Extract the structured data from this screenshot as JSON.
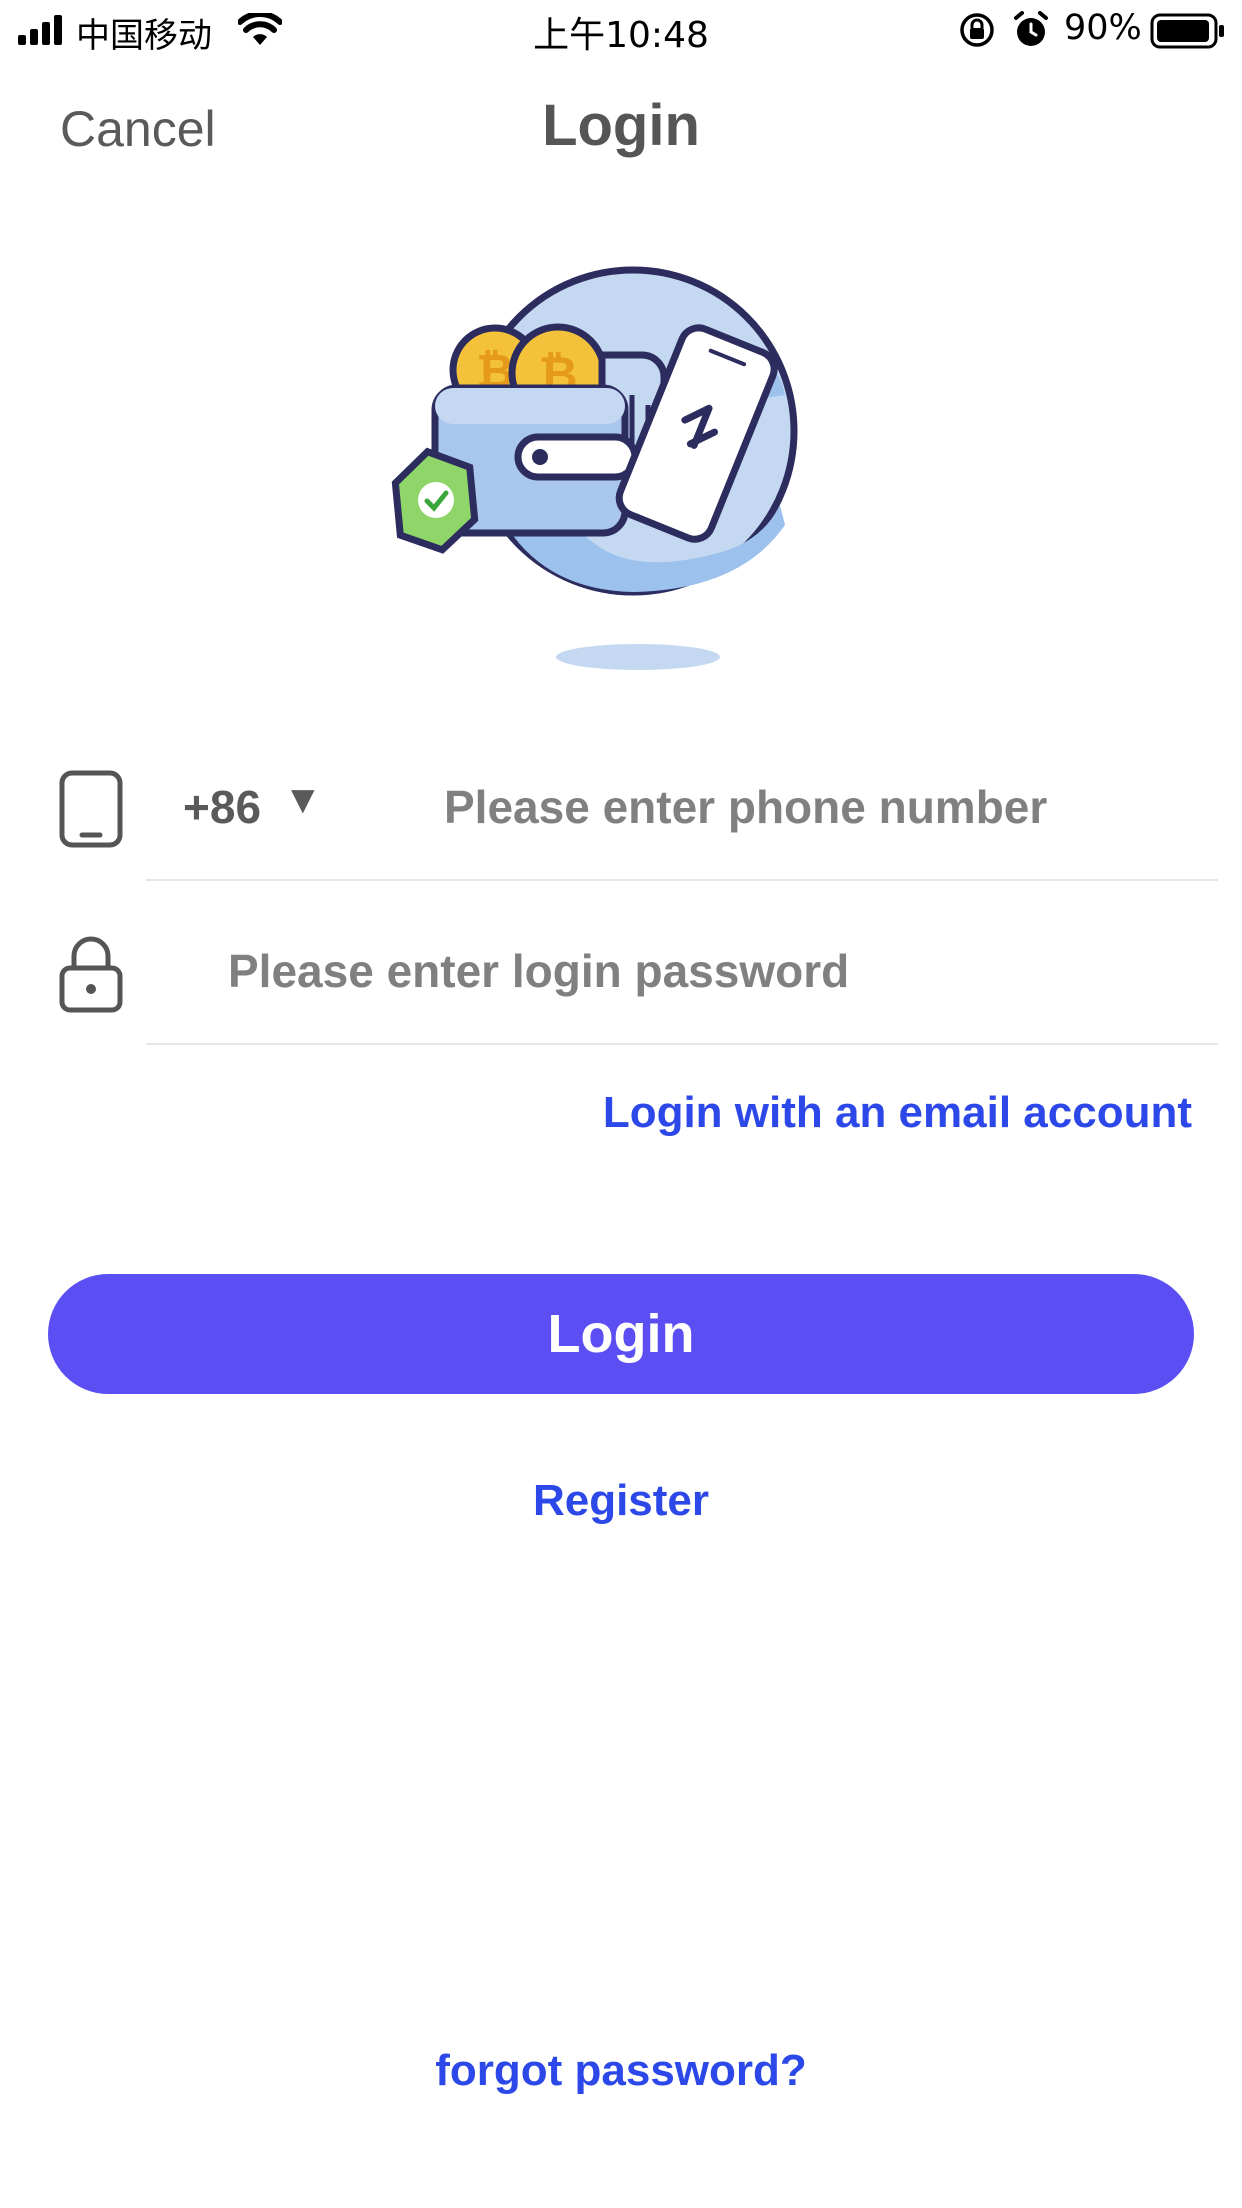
{
  "status_bar": {
    "carrier": "中国移动",
    "time": "上午10:48",
    "battery": "90%",
    "icons": [
      "signal-icon",
      "wifi-icon",
      "rotation-lock-icon",
      "alarm-icon",
      "battery-icon"
    ]
  },
  "nav": {
    "cancel_label": "Cancel",
    "title": "Login"
  },
  "illustration": {
    "icons": [
      "globe-icon",
      "wallet-icon",
      "bitcoin-coin-icon",
      "shield-check-icon",
      "phone-transfer-icon"
    ]
  },
  "form": {
    "phone_icon": "phone-icon",
    "country_code": "+86",
    "country_arrow": "▼",
    "phone_placeholder": "Please enter phone number",
    "phone_value": "",
    "lock_icon": "lock-icon",
    "password_placeholder": "Please enter login password",
    "password_value": "",
    "email_login_label": "Login with an email account",
    "login_label": "Login",
    "register_label": "Register",
    "forgot_label": "forgot password?"
  },
  "colors": {
    "accent": "#5b4ff3",
    "link": "#2d48e8",
    "text": "#555555",
    "placeholder": "#808080"
  }
}
